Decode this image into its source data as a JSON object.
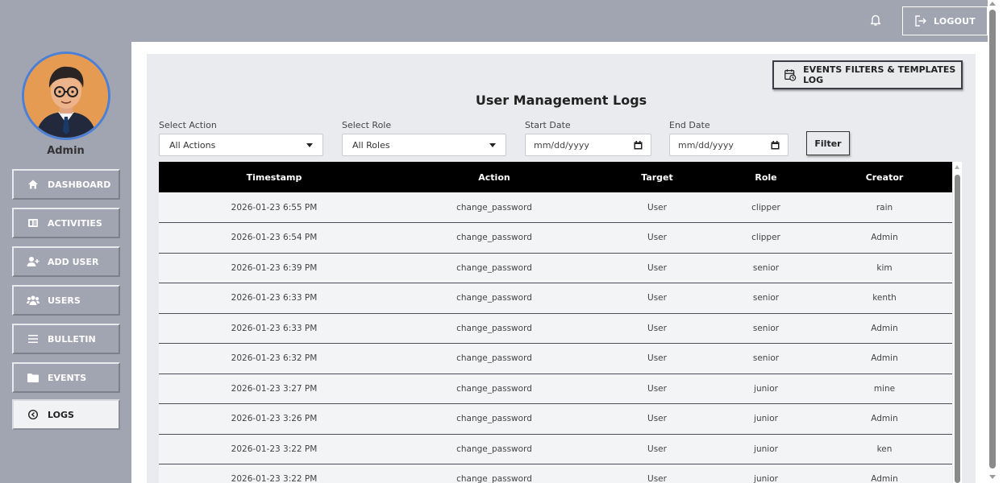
{
  "header": {
    "logout_label": "LOGOUT"
  },
  "sidebar": {
    "user_name": "Admin",
    "items": [
      {
        "label": "DASHBOARD",
        "icon": "home-icon",
        "active": false
      },
      {
        "label": "ACTIVITIES",
        "icon": "activities-icon",
        "active": false
      },
      {
        "label": "ADD USER",
        "icon": "add-user-icon",
        "active": false
      },
      {
        "label": "USERS",
        "icon": "users-icon",
        "active": false
      },
      {
        "label": "BULLETIN",
        "icon": "menu-icon",
        "active": false
      },
      {
        "label": "EVENTS",
        "icon": "folder-icon",
        "active": false
      },
      {
        "label": "LOGS",
        "icon": "history-icon",
        "active": true
      }
    ]
  },
  "main": {
    "events_button_label": "EVENTS FILTERS & TEMPLATES LOG",
    "title": "User Management Logs",
    "filters": {
      "action_label": "Select Action",
      "action_value": "All Actions",
      "role_label": "Select Role",
      "role_value": "All Roles",
      "start_label": "Start Date",
      "start_placeholder": "mm/dd/yyyy",
      "end_label": "End Date",
      "end_placeholder": "mm/dd/yyyy",
      "filter_button": "Filter"
    },
    "table": {
      "columns": [
        "Timestamp",
        "Action",
        "Target",
        "Role",
        "Creator"
      ],
      "rows": [
        [
          "2026-01-23 6:55 PM",
          "change_password",
          "User",
          "clipper",
          "rain"
        ],
        [
          "2026-01-23 6:54 PM",
          "change_password",
          "User",
          "clipper",
          "Admin"
        ],
        [
          "2026-01-23 6:39 PM",
          "change_password",
          "User",
          "senior",
          "kim"
        ],
        [
          "2026-01-23 6:33 PM",
          "change_password",
          "User",
          "senior",
          "kenth"
        ],
        [
          "2026-01-23 6:33 PM",
          "change_password",
          "User",
          "senior",
          "Admin"
        ],
        [
          "2026-01-23 6:32 PM",
          "change_password",
          "User",
          "senior",
          "Admin"
        ],
        [
          "2026-01-23 3:27 PM",
          "change_password",
          "User",
          "junior",
          "mine"
        ],
        [
          "2026-01-23 3:26 PM",
          "change_password",
          "User",
          "junior",
          "Admin"
        ],
        [
          "2026-01-23 3:22 PM",
          "change_password",
          "User",
          "junior",
          "ken"
        ],
        [
          "2026-01-23 3:22 PM",
          "change_password",
          "User",
          "junior",
          "Admin"
        ]
      ]
    }
  }
}
